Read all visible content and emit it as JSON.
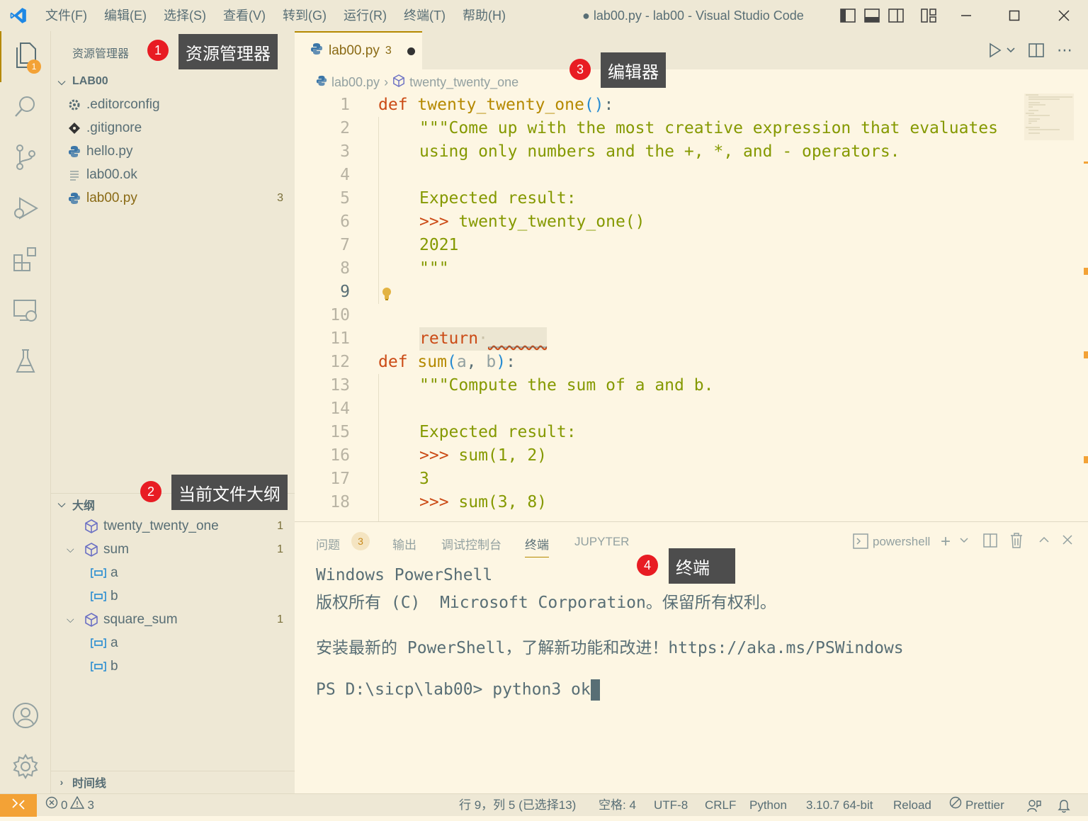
{
  "titlebar": {
    "menu": [
      "文件(F)",
      "编辑(E)",
      "选择(S)",
      "查看(V)",
      "转到(G)",
      "运行(R)",
      "终端(T)",
      "帮助(H)"
    ],
    "window_title": "● lab00.py - lab00 - Visual Studio Code"
  },
  "activity": {
    "explorer_badge": "1"
  },
  "sidebar": {
    "title": "资源管理器",
    "folder": "LAB00",
    "files": [
      {
        "name": ".editorconfig",
        "icon": "gear-icon"
      },
      {
        "name": ".gitignore",
        "icon": "git-icon"
      },
      {
        "name": "hello.py",
        "icon": "python-icon"
      },
      {
        "name": "lab00.ok",
        "icon": "lines-icon"
      },
      {
        "name": "lab00.py",
        "icon": "python-icon",
        "count": "3"
      }
    ],
    "outline_title": "大纲",
    "outline": [
      {
        "name": "twenty_twenty_one",
        "count": "1"
      },
      {
        "name": "sum",
        "count": "1"
      },
      {
        "name": "a"
      },
      {
        "name": "b"
      },
      {
        "name": "square_sum",
        "count": "1"
      },
      {
        "name": "a"
      },
      {
        "name": "b"
      }
    ],
    "timeline_title": "时间线"
  },
  "callouts": [
    {
      "num": "1",
      "text": "资源管理器"
    },
    {
      "num": "2",
      "text": "当前文件大纲"
    },
    {
      "num": "3",
      "text": "编辑器"
    },
    {
      "num": "4",
      "text": "终端"
    }
  ],
  "editor": {
    "tab_label": "lab00.py",
    "tab_problems": "3",
    "breadcrumb": [
      "lab00.py",
      "twenty_twenty_one"
    ],
    "line_numbers": [
      "1",
      "2",
      "3",
      "4",
      "5",
      "6",
      "7",
      "8",
      "9",
      "10",
      "11",
      "12",
      "13",
      "14",
      "15",
      "16",
      "17",
      "18"
    ],
    "code": {
      "l1_def": "def",
      "l1_name": "twenty_twenty_one",
      "l1_parens": "()",
      "l1_colon": ":",
      "l2": "\"\"\"Come up with the most creative expression that evaluates",
      "l3": "using only numbers and the +, *, and - operators.",
      "l5": "Expected result:",
      "l6_prompt": ">>>",
      "l6_call": " twenty_twenty_one()",
      "l7": "2021",
      "l8": "\"\"\"",
      "l9_kw": "return",
      "l9_blank": "______",
      "l12_def": "def",
      "l12_name": "sum",
      "l12_open": "(",
      "l12_a": "a",
      "l12_comma": ", ",
      "l12_b": "b",
      "l12_close": ")",
      "l12_colon": ":",
      "l13": "\"\"\"Compute the sum of a and b.",
      "l15": "Expected result:",
      "l16_prompt": ">>>",
      "l16_call": " sum(1, 2)",
      "l17": "3",
      "l18_prompt": ">>>",
      "l18_call": " sum(3, 8)"
    }
  },
  "panel": {
    "tabs": [
      "问题",
      "输出",
      "调试控制台",
      "终端",
      "JUPYTER"
    ],
    "problems_badge": "3",
    "shell": "powershell",
    "terminal_lines": [
      "Windows PowerShell",
      "版权所有 (C)  Microsoft Corporation。保留所有权利。",
      "",
      "安装最新的 PowerShell，了解新功能和改进！https://aka.ms/PSWindows",
      "",
      "PS D:\\sicp\\lab00> python3 ok"
    ]
  },
  "statusbar": {
    "errors": "0",
    "warnings": "3",
    "position": "行 9，列 5 (已选择13)",
    "spaces": "空格: 4",
    "encoding": "UTF-8",
    "eol": "CRLF",
    "language": "Python",
    "interpreter": "3.10.7 64-bit",
    "reload": "Reload",
    "prettier": "Prettier"
  },
  "colors": {
    "accent": "#b58900",
    "background": "#fdf6e3",
    "chrome": "#eee8d5",
    "callout": "#4d4d4d",
    "callout_num": "#e81c23"
  }
}
